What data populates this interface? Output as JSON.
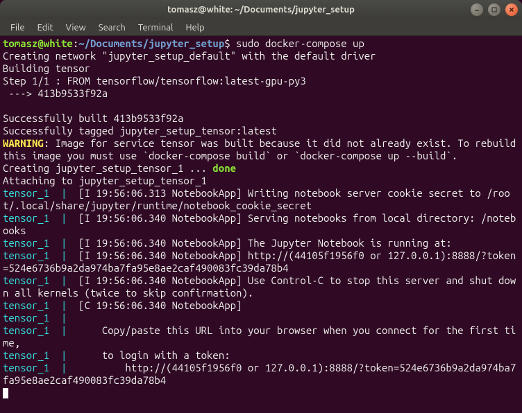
{
  "titlebar": {
    "title": "tomasz@white: ~/Documents/jupyter_setup"
  },
  "menubar": {
    "file": "File",
    "edit": "Edit",
    "view": "View",
    "search": "Search",
    "terminal": "Terminal",
    "help": "Help"
  },
  "prompt": {
    "userhost": "tomasz@white",
    "colon": ":",
    "path": "~/Documents/jupyter_setup",
    "dollar": "$ ",
    "command": "sudo docker-compose up"
  },
  "lines": {
    "l1": "Creating network \"jupyter_setup_default\" with the default driver",
    "l2": "Building tensor",
    "l3": "Step 1/1 : FROM tensorflow/tensorflow:latest-gpu-py3",
    "l4": " ---> 413b9533f92a",
    "l5": "",
    "l6": "Successfully built 413b9533f92a",
    "l7": "Successfully tagged jupyter_setup_tensor:latest",
    "warn_label": "WARNING",
    "warn_text": ": Image for service tensor was built because it did not already exist. To rebuild this image you must use `docker-compose build` or `docker-compose up --build`.",
    "l9a": "Creating jupyter_setup_tensor_1 ... ",
    "l9b": "done",
    "l10": "Attaching to jupyter_setup_tensor_1",
    "prefix": "tensor_1",
    "pipe": "  | ",
    "t1": " [I 19:56:06.313 NotebookApp] Writing notebook server cookie secret to /root/.local/share/jupyter/runtime/notebook_cookie_secret",
    "t2": " [I 19:56:06.340 NotebookApp] Serving notebooks from local directory: /notebooks",
    "t3": " [I 19:56:06.340 NotebookApp] The Jupyter Notebook is running at:",
    "t4": " [I 19:56:06.340 NotebookApp] http://(44105f1956f0 or 127.0.0.1):8888/?token=524e6736b9a2da974ba7fa95e8ae2caf490083fc39da78b4",
    "t5": " [I 19:56:06.340 NotebookApp] Use Control-C to stop this server and shut down all kernels (twice to skip confirmation).",
    "t6": " [C 19:56:06.340 NotebookApp] ",
    "t7": " ",
    "t8": "     Copy/paste this URL into your browser when you connect for the first time,",
    "t9": "     to login with a token:",
    "t10": "         http://(44105f1956f0 or 127.0.0.1):8888/?token=524e6736b9a2da974ba7fa95e8ae2caf490083fc39da78b4"
  }
}
